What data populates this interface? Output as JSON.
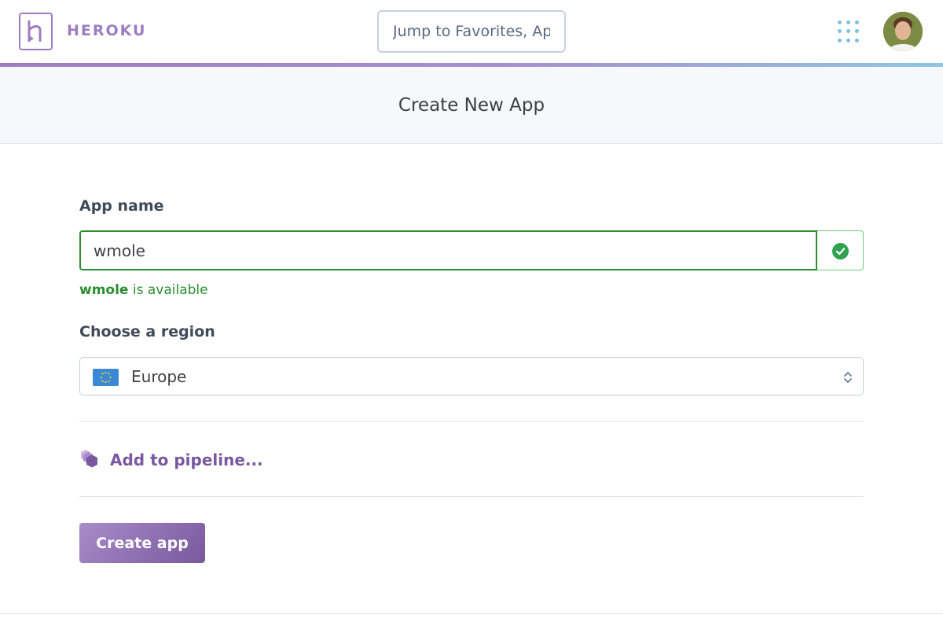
{
  "header": {
    "brand": "HEROKU",
    "search_placeholder": "Jump to Favorites, Apps, Pipelines, Spaces..."
  },
  "page": {
    "title": "Create New App"
  },
  "form": {
    "app_name_label": "App name",
    "app_name_value": "wmole",
    "availability_name": "wmole",
    "availability_suffix": " is available",
    "region_label": "Choose a region",
    "region_value": "Europe",
    "pipeline_link": "Add to pipeline...",
    "create_button": "Create app"
  },
  "colors": {
    "accent": "#79589f",
    "success": "#2a8e2f"
  }
}
